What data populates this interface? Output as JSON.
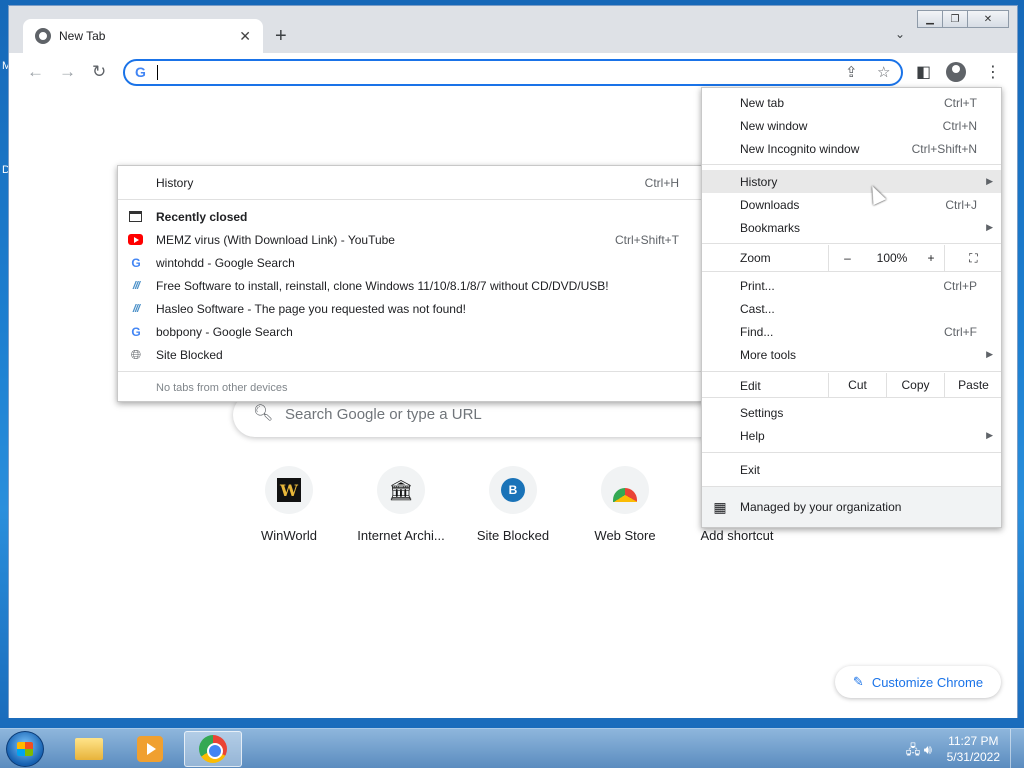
{
  "browser": {
    "tab_title": "New Tab",
    "omnibox_value": "",
    "search_placeholder": "Search Google or type a URL",
    "shortcuts": [
      {
        "label": "WinWorld",
        "tile": "W"
      },
      {
        "label": "Internet Archi...",
        "tile": "🏛"
      },
      {
        "label": "Site Blocked",
        "tile": "B"
      },
      {
        "label": "Web Store",
        "tile": ""
      },
      {
        "label": "Add shortcut",
        "tile": ""
      }
    ],
    "customize_label": "Customize Chrome"
  },
  "chrome_menu": {
    "new_tab": {
      "label": "New tab",
      "shortcut": "Ctrl+T"
    },
    "new_window": {
      "label": "New window",
      "shortcut": "Ctrl+N"
    },
    "new_incognito": {
      "label": "New Incognito window",
      "shortcut": "Ctrl+Shift+N"
    },
    "history": {
      "label": "History"
    },
    "downloads": {
      "label": "Downloads",
      "shortcut": "Ctrl+J"
    },
    "bookmarks": {
      "label": "Bookmarks"
    },
    "zoom": {
      "label": "Zoom",
      "minus": "–",
      "value": "100%",
      "plus": "+"
    },
    "print": {
      "label": "Print...",
      "shortcut": "Ctrl+P"
    },
    "cast": {
      "label": "Cast..."
    },
    "find": {
      "label": "Find...",
      "shortcut": "Ctrl+F"
    },
    "more_tools": {
      "label": "More tools"
    },
    "edit": {
      "label": "Edit",
      "cut": "Cut",
      "copy": "Copy",
      "paste": "Paste"
    },
    "settings": {
      "label": "Settings"
    },
    "help": {
      "label": "Help"
    },
    "exit": {
      "label": "Exit"
    },
    "managed": {
      "label": "Managed by your organization"
    }
  },
  "history_menu": {
    "history": {
      "label": "History",
      "shortcut": "Ctrl+H"
    },
    "recently_closed": "Recently closed",
    "items": [
      {
        "label": "MEMZ virus (With Download Link) - YouTube",
        "shortcut": "Ctrl+Shift+T",
        "icon": "youtube-icon"
      },
      {
        "label": "wintohdd - Google Search",
        "shortcut": "",
        "icon": "google-icon"
      },
      {
        "label": "Free Software to install, reinstall, clone Windows 11/10/8.1/8/7 without CD/DVD/USB!",
        "shortcut": "",
        "icon": "hasleo-icon"
      },
      {
        "label": "Hasleo Software - The page you requested was not found!",
        "shortcut": "",
        "icon": "hasleo-icon"
      },
      {
        "label": "bobpony - Google Search",
        "shortcut": "",
        "icon": "google-icon"
      },
      {
        "label": "Site Blocked",
        "shortcut": "",
        "icon": "globe-icon"
      }
    ],
    "no_tabs": "No tabs from other devices"
  },
  "taskbar": {
    "time": "11:27 PM",
    "date": "5/31/2022"
  }
}
